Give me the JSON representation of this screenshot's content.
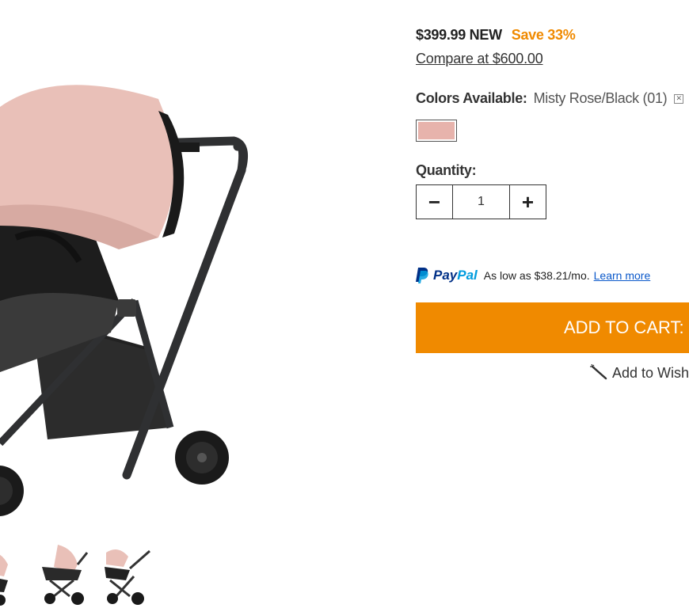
{
  "product": {
    "price": "$399.99 NEW",
    "save": "Save 33%",
    "compare": "Compare at $600.00"
  },
  "colors": {
    "label": "Colors Available:",
    "selected": "Misty Rose/Black (01)",
    "clear_glyph": "✕",
    "swatch_color": "#e7b3ac"
  },
  "quantity": {
    "label": "Quantity:",
    "minus": "−",
    "value": "1",
    "plus": "+"
  },
  "paypal": {
    "brand_part1": "Pay",
    "brand_part2": "Pal",
    "offer": "As low as $38.21/mo.",
    "link": "Learn more"
  },
  "cart": {
    "label": "ADD TO CART: $"
  },
  "wishlist": {
    "label": "Add to Wish"
  },
  "thumbnails": [
    "stroller-seat-view",
    "stroller-bassinet-view",
    "stroller-side-view"
  ],
  "accent_color": "#f08a00"
}
